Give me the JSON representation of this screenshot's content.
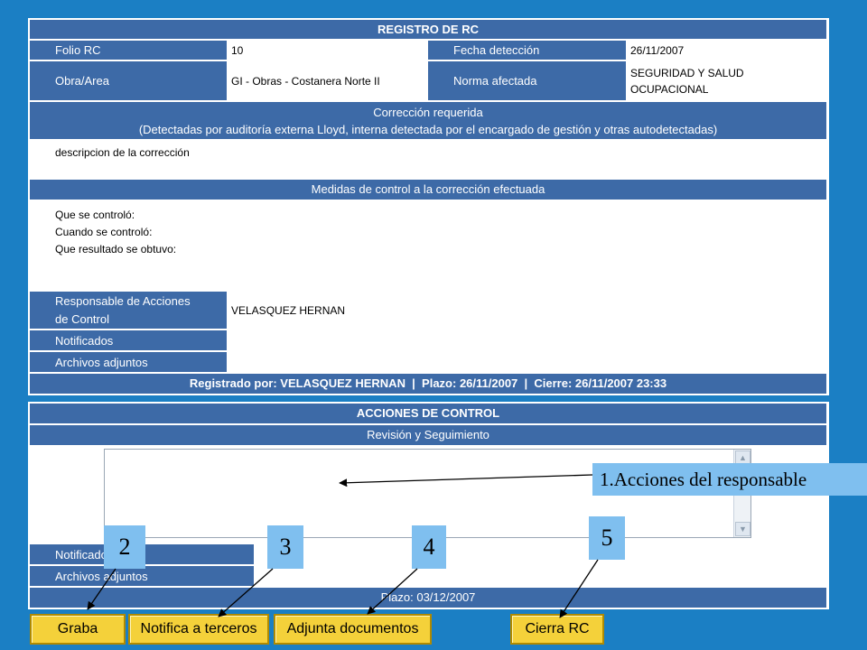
{
  "registro": {
    "title": "REGISTRO DE RC",
    "folio_label": "Folio RC",
    "folio_value": "10",
    "fecha_label": "Fecha detección",
    "fecha_value": "26/11/2007",
    "obra_label": "Obra/Area",
    "obra_value": "GI - Obras - Costanera Norte II",
    "norma_label": "Norma afectada",
    "norma_value_line1": "SEGURIDAD Y SALUD",
    "norma_value_line2": "OCUPACIONAL",
    "correccion_title": "Corrección requerida",
    "correccion_subtitle": "(Detectadas por auditoría externa Lloyd, interna detectada por el encargado de gestión y otras autodetectadas)",
    "correccion_text": "descripcion de la corrección",
    "medidas_title": "Medidas de control a la corrección efectuada",
    "medidas_line1": "Que se controló:",
    "medidas_line2": "Cuando se controló:",
    "medidas_line3": "Que resultado se obtuvo:",
    "responsable_label_line1": "Responsable de Acciones",
    "responsable_label_line2": "de Control",
    "responsable_value": "VELASQUEZ HERNAN",
    "notificados_label": "Notificados",
    "archivos_label": "Archivos adjuntos",
    "footer": "Registrado por: VELASQUEZ HERNAN  |  Plazo: 26/11/2007  |  Cierre: 26/11/2007 23:33"
  },
  "acciones": {
    "title": "ACCIONES DE CONTROL",
    "subtitle": "Revisión y Seguimiento",
    "textarea_value": "",
    "notificados_label": "Notificados",
    "archivos_label": "Archivos adjuntos",
    "plazo": "Plazo: 03/12/2007"
  },
  "buttons": {
    "graba": "Graba",
    "notifica": "Notifica a terceros",
    "adjunta": "Adjunta documentos",
    "cierra": "Cierra RC"
  },
  "callouts": {
    "c1": "1.Acciones del responsable",
    "c2": "2",
    "c3": "3",
    "c4": "4",
    "c5": "5"
  },
  "colors": {
    "background": "#1b7fc4",
    "header": "#3d6aa7",
    "button": "#f4d13a",
    "callout": "#7fbfef"
  }
}
